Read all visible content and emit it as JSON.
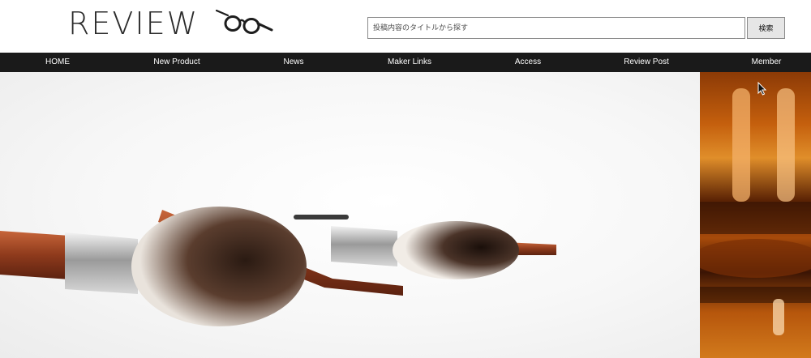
{
  "header": {
    "logo_text": "REVIEW",
    "logo_icon": "glasses-icon",
    "search": {
      "placeholder": "投稿内容のタイトルから探す",
      "button_label": "検索"
    }
  },
  "nav": {
    "items": [
      {
        "label": "HOME"
      },
      {
        "label": "New Product"
      },
      {
        "label": "News"
      },
      {
        "label": "Maker Links"
      },
      {
        "label": "Access"
      },
      {
        "label": "Review Post"
      },
      {
        "label": "Member"
      }
    ]
  },
  "hero": {
    "slides": [
      {
        "image": "makeup-brushes-photo"
      },
      {
        "image": "amber-hair-clips-photo"
      }
    ]
  },
  "colors": {
    "nav_bg": "#1a1a1a",
    "nav_text": "#ffffff",
    "logo_text": "#2b2b2b",
    "search_button_bg": "#e6e6e6"
  }
}
